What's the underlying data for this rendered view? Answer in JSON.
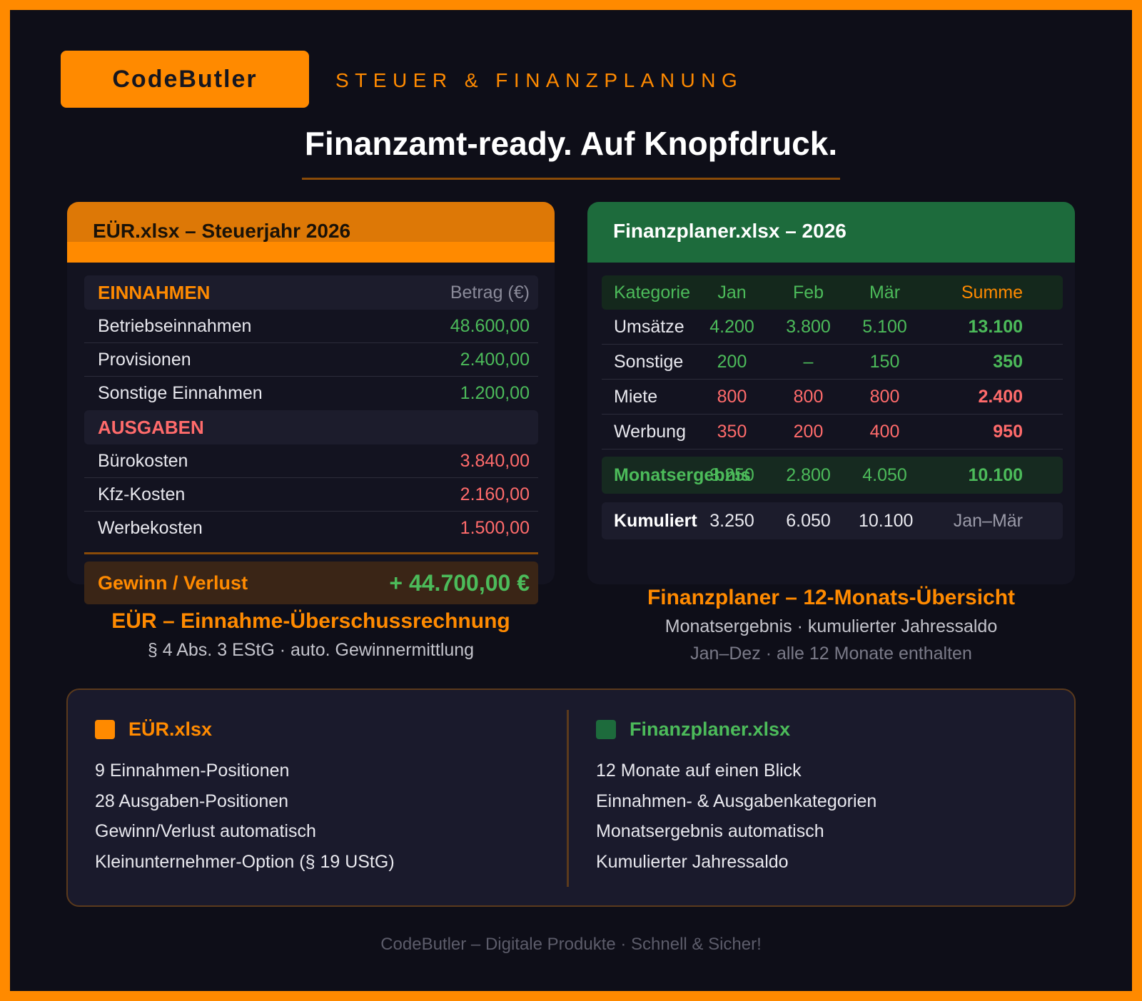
{
  "brand": "CodeButler",
  "tagline": "STEUER & FINANZPLANUNG",
  "headline": "Finanzamt-ready. Auf Knopfdruck.",
  "eur_card": {
    "title": "EÜR.xlsx – Steuerjahr 2026",
    "income_header": "EINNAHMEN",
    "amount_header": "Betrag (€)",
    "income": [
      {
        "label": "Betriebseinnahmen",
        "value": "48.600,00"
      },
      {
        "label": "Provisionen",
        "value": "2.400,00"
      },
      {
        "label": "Sonstige Einnahmen",
        "value": "1.200,00"
      }
    ],
    "expense_header": "AUSGABEN",
    "expenses": [
      {
        "label": "Bürokosten",
        "value": "3.840,00"
      },
      {
        "label": "Kfz-Kosten",
        "value": "2.160,00"
      },
      {
        "label": "Werbekosten",
        "value": "1.500,00"
      }
    ],
    "total_label": "Gewinn / Verlust",
    "total_value": "+ 44.700,00 €",
    "caption_title": "EÜR – Einnahme-Überschussrechnung",
    "caption_sub": "§ 4 Abs. 3 EStG · auto. Gewinnermittlung"
  },
  "fp_card": {
    "title": "Finanzplaner.xlsx – 2026",
    "columns": [
      "Kategorie",
      "Jan",
      "Feb",
      "Mär",
      "Summe"
    ],
    "rows": [
      {
        "cat": "Umsätze",
        "jan": "4.200",
        "feb": "3.800",
        "mar": "5.100",
        "sum": "13.100"
      },
      {
        "cat": "Sonstige",
        "jan": "200",
        "feb": "–",
        "mar": "150",
        "sum": "350"
      },
      {
        "cat": "Miete",
        "jan": "800",
        "feb": "800",
        "mar": "800",
        "sum": "2.400"
      },
      {
        "cat": "Werbung",
        "jan": "350",
        "feb": "200",
        "mar": "400",
        "sum": "950"
      }
    ],
    "result": {
      "cat": "Monatsergebnis",
      "jan": "3.250",
      "feb": "2.800",
      "mar": "4.050",
      "sum": "10.100"
    },
    "cumulative": {
      "cat": "Kumuliert",
      "jan": "3.250",
      "feb": "6.050",
      "mar": "10.100",
      "sum": "Jan–Mär"
    },
    "caption_title": "Finanzplaner – 12-Monats-Übersicht",
    "caption_sub": "Monatsergebnis · kumulierter Jahressaldo",
    "caption_sub2": "Jan–Dez · alle 12 Monate enthalten"
  },
  "info": {
    "left": {
      "title": "EÜR.xlsx",
      "items": [
        "9 Einnahmen-Positionen",
        "28 Ausgaben-Positionen",
        "Gewinn/Verlust automatisch",
        "Kleinunternehmer-Option (§ 19 UStG)"
      ]
    },
    "right": {
      "title": "Finanzplaner.xlsx",
      "items": [
        "12 Monate auf einen Blick",
        "Einnahmen- & Ausgabenkategorien",
        "Monatsergebnis automatisch",
        "Kumulierter Jahressaldo"
      ]
    }
  },
  "footer": "CodeButler – Digitale Produkte · Schnell & Sicher!",
  "colors": {
    "accent": "#ff8a00",
    "green": "#1d6b3c",
    "income": "#4cbb5a",
    "expense": "#ff6b6b",
    "background": "#0e0e18"
  }
}
